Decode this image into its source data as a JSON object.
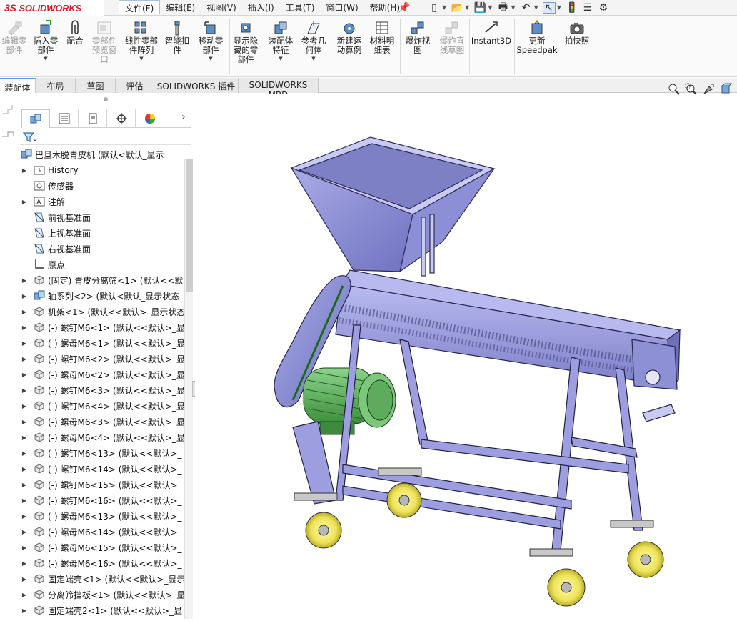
{
  "app": {
    "logo_ds": "3S",
    "logo_name": "SOLIDWORKS"
  },
  "menu": [
    {
      "label": "文件(F)"
    },
    {
      "label": "编辑(E)"
    },
    {
      "label": "视图(V)"
    },
    {
      "label": "插入(I)"
    },
    {
      "label": "工具(T)"
    },
    {
      "label": "窗口(W)"
    },
    {
      "label": "帮助(H)"
    }
  ],
  "quick_access": [
    "pin-icon",
    "new-document-icon",
    "open-icon",
    "save-icon",
    "print-icon",
    "undo-icon",
    "select-cursor-icon",
    "rebuild-icon",
    "file-properties-icon",
    "options-gear-icon"
  ],
  "ribbon": [
    {
      "label": "编辑零\n部件",
      "icon": "edit-component-icon",
      "disabled": true
    },
    {
      "label": "插入零\n部件",
      "icon": "insert-component-icon",
      "disabled": false,
      "caret": true
    },
    {
      "label": "配合",
      "icon": "mate-paperclip-icon",
      "disabled": false
    },
    {
      "label": "零部件\n预览窗\n口",
      "icon": "component-preview-icon",
      "disabled": true
    },
    {
      "label": "线性零部\n件阵列",
      "icon": "linear-pattern-icon",
      "disabled": false,
      "caret": true
    },
    {
      "label": "智能扣\n件",
      "icon": "smart-fasteners-icon",
      "disabled": false
    },
    {
      "label": "移动零\n部件",
      "icon": "move-component-icon",
      "disabled": false,
      "caret": true
    },
    {
      "label": "显示隐\n藏的零\n部件",
      "icon": "show-hidden-icon",
      "disabled": false
    },
    {
      "label": "装配体\n特征",
      "icon": "assembly-features-icon",
      "disabled": false,
      "caret": true
    },
    {
      "label": "参考几\n何体",
      "icon": "reference-geometry-icon",
      "disabled": false,
      "caret": true
    },
    {
      "label": "新建运\n动算例",
      "icon": "new-motion-study-icon",
      "disabled": false
    },
    {
      "label": "材料明\n细表",
      "icon": "bill-of-materials-icon",
      "disabled": false
    },
    {
      "label": "爆炸视\n图",
      "icon": "exploded-view-icon",
      "disabled": false
    },
    {
      "label": "爆炸直\n线草图",
      "icon": "explode-line-sketch-icon",
      "disabled": true
    },
    {
      "label": "Instant3D",
      "icon": "instant3d-icon",
      "disabled": false
    },
    {
      "label": "更新\nSpeedpak",
      "icon": "update-speedpak-icon",
      "disabled": false
    },
    {
      "label": "拍快照",
      "icon": "take-snapshot-icon",
      "disabled": false
    }
  ],
  "command_tabs": [
    {
      "label": "装配体",
      "active": true
    },
    {
      "label": "布局",
      "active": false
    },
    {
      "label": "草图",
      "active": false
    },
    {
      "label": "评估",
      "active": false
    },
    {
      "label": "SOLIDWORKS 插件",
      "active": false
    },
    {
      "label": "SOLIDWORKS MBD",
      "active": false
    }
  ],
  "featuremanager_tabs": [
    "feature-manager-tab-icon",
    "property-manager-tab-icon",
    "configuration-manager-tab-icon",
    "dimxpert-manager-tab-icon",
    "display-manager-tab-icon"
  ],
  "tree": {
    "root": {
      "label": "巴旦木脱青皮机 (默认<默认_显示",
      "icon": "assembly-icon"
    },
    "items": [
      {
        "label": "History",
        "icon": "history-folder-icon",
        "expandable": true
      },
      {
        "label": "传感器",
        "icon": "sensors-folder-icon",
        "expandable": false
      },
      {
        "label": "注解",
        "icon": "annotations-icon",
        "expandable": true
      },
      {
        "label": "前视基准面",
        "icon": "plane-icon",
        "expandable": false
      },
      {
        "label": "上视基准面",
        "icon": "plane-icon",
        "expandable": false
      },
      {
        "label": "右视基准面",
        "icon": "plane-icon",
        "expandable": false
      },
      {
        "label": "原点",
        "icon": "origin-icon",
        "expandable": false
      },
      {
        "label": "(固定) 青皮分离筛<1> (默认<<默",
        "icon": "part-icon",
        "expandable": true
      },
      {
        "label": "轴系列<2> (默认<默认_显示状态-",
        "icon": "subassembly-icon",
        "expandable": true
      },
      {
        "label": "机架<1> (默认<<默认>_显示状态",
        "icon": "part-icon",
        "expandable": true
      },
      {
        "label": "(-) 螺钉M6<1> (默认<<默认>_显",
        "icon": "part-icon",
        "expandable": true
      },
      {
        "label": "(-) 螺母M6<1> (默认<<默认>_显",
        "icon": "part-icon",
        "expandable": true
      },
      {
        "label": "(-) 螺钉M6<2> (默认<<默认>_显",
        "icon": "part-icon",
        "expandable": true
      },
      {
        "label": "(-) 螺母M6<2> (默认<<默认>_显",
        "icon": "part-icon",
        "expandable": true
      },
      {
        "label": "(-) 螺钉M6<3> (默认<<默认>_显",
        "icon": "part-icon",
        "expandable": true
      },
      {
        "label": "(-) 螺钉M6<4> (默认<<默认>_显",
        "icon": "part-icon",
        "expandable": true
      },
      {
        "label": "(-) 螺母M6<3> (默认<<默认>_显",
        "icon": "part-icon",
        "expandable": true
      },
      {
        "label": "(-) 螺母M6<4> (默认<<默认>_显",
        "icon": "part-icon",
        "expandable": true
      },
      {
        "label": "(-) 螺钉M6<13> (默认<<默认>_",
        "icon": "part-icon",
        "expandable": true
      },
      {
        "label": "(-) 螺钉M6<14> (默认<<默认>_",
        "icon": "part-icon",
        "expandable": true
      },
      {
        "label": "(-) 螺钉M6<15> (默认<<默认>_",
        "icon": "part-icon",
        "expandable": true
      },
      {
        "label": "(-) 螺钉M6<16> (默认<<默认>_",
        "icon": "part-icon",
        "expandable": true
      },
      {
        "label": "(-) 螺母M6<13> (默认<<默认>_",
        "icon": "part-icon",
        "expandable": true
      },
      {
        "label": "(-) 螺母M6<14> (默认<<默认>_",
        "icon": "part-icon",
        "expandable": true
      },
      {
        "label": "(-) 螺母M6<15> (默认<<默认>_",
        "icon": "part-icon",
        "expandable": true
      },
      {
        "label": "(-) 螺母M6<16> (默认<<默认>_",
        "icon": "part-icon",
        "expandable": true
      },
      {
        "label": "固定端壳<1> (默认<<默认>_显示",
        "icon": "part-icon",
        "expandable": true
      },
      {
        "label": "分离筛挡板<1> (默认<<默认>_显",
        "icon": "part-icon",
        "expandable": true
      },
      {
        "label": "固定端壳2<1> (默认<<默认>_显",
        "icon": "part-icon",
        "expandable": true
      }
    ]
  },
  "view_tools": [
    "zoom-to-fit-icon",
    "zoom-to-area-icon",
    "previous-view-icon",
    "section-view-icon"
  ],
  "colors": {
    "logo_red": "#d42027",
    "tab_accent": "#5b9bd5",
    "machine_body": "#9d9ee0",
    "motor": "#5bb35b",
    "wheel": "#f2ee6e"
  }
}
